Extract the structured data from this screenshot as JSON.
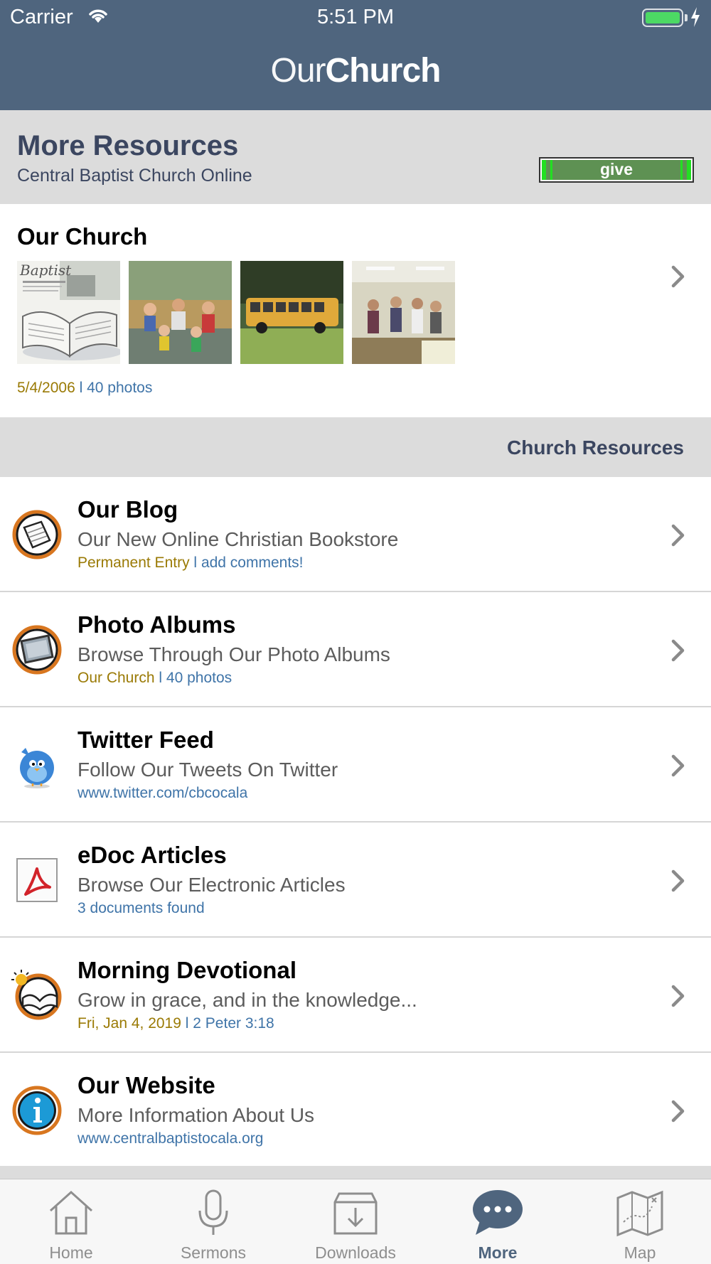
{
  "status_bar": {
    "carrier": "Carrier",
    "time": "5:51 PM"
  },
  "nav": {
    "brand_light": "Our",
    "brand_bold": "Church"
  },
  "header": {
    "title": "More Resources",
    "subtitle": "Central Baptist Church Online",
    "give_label": "give"
  },
  "album": {
    "title": "Our Church",
    "date": "5/4/2006",
    "separator": "l",
    "count": "40 photos"
  },
  "section": {
    "title": "Church Resources"
  },
  "items": [
    {
      "title": "Our Blog",
      "subtitle": "Our New Online Christian Bookstore",
      "meta_a": "Permanent Entry",
      "meta_sep": "l",
      "meta_b": "add comments!"
    },
    {
      "title": "Photo Albums",
      "subtitle": "Browse Through Our Photo Albums",
      "meta_a": "Our Church",
      "meta_sep": "l",
      "meta_b": "40 photos"
    },
    {
      "title": "Twitter Feed",
      "subtitle": "Follow Our Tweets On Twitter",
      "meta_a": "",
      "meta_sep": "",
      "meta_b": "www.twitter.com/cbcocala"
    },
    {
      "title": "eDoc Articles",
      "subtitle": "Browse Our Electronic Articles",
      "meta_a": "",
      "meta_sep": "",
      "meta_b": "3 documents found"
    },
    {
      "title": "Morning Devotional",
      "subtitle": "Grow in grace, and in the knowledge...",
      "meta_a": "Fri, Jan 4, 2019",
      "meta_sep": "l",
      "meta_b": "2 Peter 3:18"
    },
    {
      "title": "Our Website",
      "subtitle": "More Information About Us",
      "meta_a": "",
      "meta_sep": "",
      "meta_b": "www.centralbaptistocala.org"
    }
  ],
  "tabs": [
    {
      "label": "Home",
      "icon": "home-icon"
    },
    {
      "label": "Sermons",
      "icon": "microphone-icon"
    },
    {
      "label": "Downloads",
      "icon": "download-tray-icon"
    },
    {
      "label": "More",
      "icon": "chat-bubble-icon"
    },
    {
      "label": "Map",
      "icon": "map-icon"
    }
  ],
  "colors": {
    "nav_bar": "#4f657e",
    "header_bg": "#dcdcdc",
    "title_text": "#3b4660",
    "meta_gold": "#9a7a05",
    "meta_blue": "#3f74a8",
    "give_green": "#5e9153"
  }
}
